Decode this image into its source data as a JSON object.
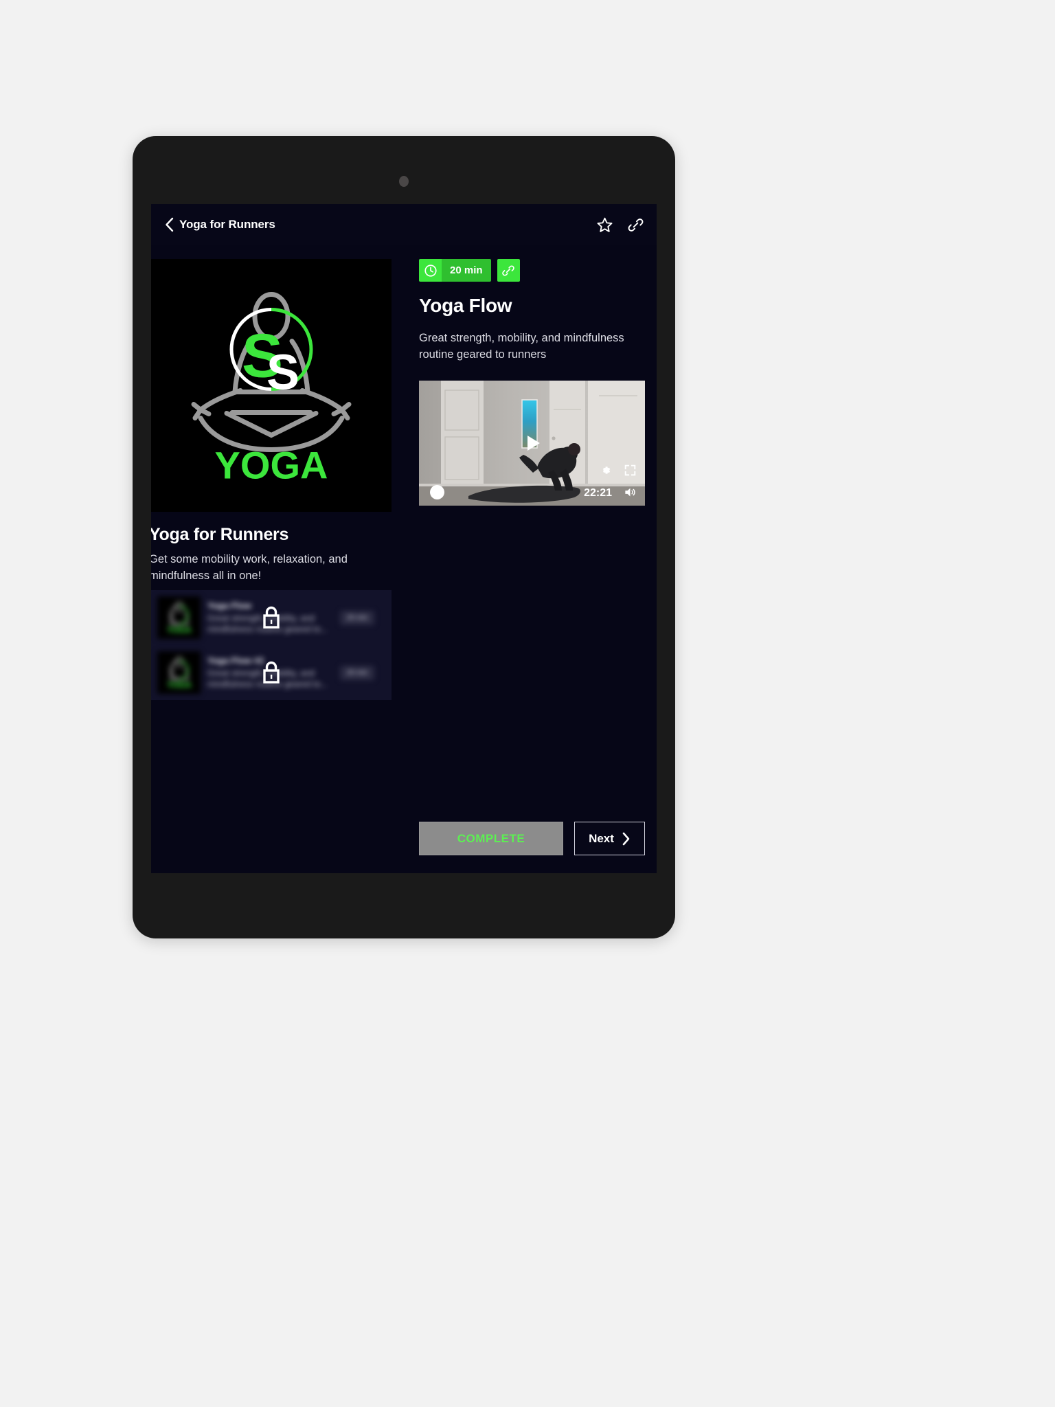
{
  "header": {
    "title": "Yoga for Runners",
    "back_icon": "chevron-left-icon",
    "favorite_icon": "star-icon",
    "share_icon": "link-icon"
  },
  "left_panel": {
    "hero": {
      "brand_letter_green": "S",
      "brand_letter_white": "S",
      "wordmark": "YOGA"
    },
    "heading": "Yoga for Runners",
    "description": "Get some mobility work, relaxation, and mindfulness all in one!",
    "lessons": [
      {
        "title": "Yoga Flow",
        "description": "Great strength, mobility, and mindfulness routine geared to...",
        "duration": "20 min",
        "locked": true,
        "lock_icon": "lock-icon"
      },
      {
        "title": "Yoga Flow #2",
        "description": "Great strength, mobility, and mindfulness routine geared to...",
        "duration": "20 min",
        "locked": true,
        "lock_icon": "lock-icon"
      }
    ]
  },
  "right_panel": {
    "duration_badge": {
      "icon": "clock-icon",
      "label": "20 min"
    },
    "share_button_icon": "link-icon",
    "title": "Yoga Flow",
    "description": "Great strength, mobility, and mindfulness routine geared to runners",
    "video": {
      "play_icon": "play-icon",
      "settings_icon": "gear-icon",
      "fullscreen_icon": "fullscreen-icon",
      "volume_icon": "volume-icon",
      "time": "22:21",
      "scrubber_icon": "scrubber-handle"
    }
  },
  "footer": {
    "complete_label": "COMPLETE",
    "next_label": "Next",
    "next_icon": "chevron-right-icon"
  },
  "colors": {
    "accent_green_bright": "#3ce63c",
    "accent_green_dark": "#2fbf2f",
    "complete_text_green": "#5cf052",
    "screen_background": "#060617",
    "device_frame": "#1a1a1a",
    "page_background": "#f2f2f2"
  }
}
